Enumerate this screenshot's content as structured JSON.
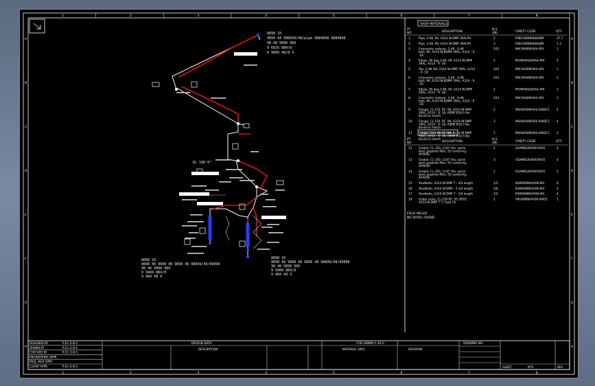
{
  "drawing": {
    "grid_top_numbers": [
      "1",
      "2",
      "3",
      "4",
      "5",
      "6",
      "7",
      "8"
    ],
    "grid_side_letters": [
      "A",
      "B",
      "C",
      "D",
      "E",
      "F",
      "G",
      "H"
    ]
  },
  "shop_parts": {
    "title": "SHOP MATERIALS",
    "col_pt": "PT\nNO",
    "col_desc": "DESCRIPTION",
    "col_nd": "N.S.\n(IN)",
    "col_code": "CMDTY CODE",
    "col_qty": "QTY",
    "rows": [
      {
        "pt": "1",
        "desc": "Pipe, 3-48 ,90, A314 W-DMP 39ALPH",
        "nd": "2",
        "code": "P4841W0N6N4848M",
        "qty": "37.7"
      },
      {
        "pt": "2",
        "desc": "Pipe, 3-48 ,90, A314 W-DMP 39ALPH",
        "nd": "3",
        "code": "P4841W0N6N4848M",
        "qty": "1.3"
      },
      {
        "pt": "3",
        "desc": "Concentric reducer, 2-48 , A-48 butt, 90, A314 W-BDMP 39AL, A314 - 9 -18",
        "nd": "2X3",
        "code": "M6C4H60WI4A4-4P4",
        "qty": "1"
      },
      {
        "pt": "4",
        "desc": "Elbow, 90 deg 3-48 ,90, A314 W-DMP 39AL, A314 - 9 -18",
        "nd": "2",
        "code": "MCM6406LW4A4-4P4",
        "qty": "4"
      },
      {
        "pt": "5",
        "desc": "Tee, 2-48 ,90, A314 W-DMP 39AL, A314 - 9 -18",
        "nd": "2X3",
        "code": "M6C4H60WI4A4-4P4",
        "qty": "1"
      },
      {
        "pt": "6",
        "desc": "Concentric reducer, 2-48 , A-48 butt, 90, A314 W-BDMP 39AL, A314 - 9 -18",
        "nd": "2X3",
        "code": "M6C4H60WI4A4-4P4",
        "qty": "2"
      },
      {
        "pt": "7",
        "desc": "Elbow, 90 deg 3-48 ,90, A314 W-DMP 39AL, A314 - 9 -18",
        "nd": "2",
        "code": "MCM6406LW4A4-4P4",
        "qty": "3"
      },
      {
        "pt": "8",
        "desc": "Concentric reducer, 2-48 , A-48 butt, 90, A314 W-BDMP 39AL, A314 - 9 -18",
        "nd": "2X3",
        "code": "M6C4H60WI4A4-4P4",
        "qty": "2"
      },
      {
        "pt": "9",
        "desc": "Flange, CL-150, RF, 90, A314 W-DMP 39AL, A314 - 9 -18, ASME B16.5 lbs bored to match",
        "nd": "2",
        "code": "M6A4H60WI4A4-406DC1",
        "qty": "4"
      },
      {
        "pt": "10",
        "desc": "Flange, CL-150, RF, 90, A314 W-DMP 39AL, A314 - 9 -18, ASME B16.5 lbs bored to match",
        "nd": "3",
        "code": "M6A4H60WI4A4-406DC1",
        "qty": "4"
      },
      {
        "pt": "11",
        "desc": "Flange, CL-150, RF, 90, A314 W-DMP 39AL, A314 - 9 -18, ASME B16.5 lbs bored to match",
        "nd": "2",
        "code": "M6A4H60WI4A4-406DC1",
        "qty": "2"
      }
    ]
  },
  "erection": {
    "title": "ERECTION MATERIALS",
    "col_pt": "PT\nNO",
    "col_desc": "DESCRIPTION",
    "col_nd": "N.S.\n(IN)",
    "col_code": "CMDTY CODE",
    "col_qty": "QTY",
    "rows": [
      {
        "pt": "12",
        "desc": "Gasket, CL-150, 1/16\" thk, spiral wnd, graphite filler, SS centering, AF9458",
        "nd": "2",
        "code": "GSAM6GAE9001P4U5",
        "qty": "4"
      },
      {
        "pt": "13",
        "desc": "Gasket, CL-150, 1/16\" thk, spiral wnd, graphite filler, SS centering, AF9458",
        "nd": "3",
        "code": "GSAM6GAE9001P4U5",
        "qty": "4"
      },
      {
        "pt": "14",
        "desc": "Gasket, CL-150, 1/16\" thk, spiral wnd, graphite filler, SS centering, AF9458",
        "nd": "2",
        "code": "GSAM6GAE9001P4U5",
        "qty": "2"
      },
      {
        "pt": "15",
        "desc": "Studbolts, A314 W-DMP 7 - 3/4 length",
        "nd": "1/2",
        "code": "B4W6W6NA4V89-W4",
        "qty": "8"
      },
      {
        "pt": "16",
        "desc": "Studbolts, A314 W-DMP - 3 3/4 length",
        "nd": "5/8",
        "code": "B4W6W6NA4V89-W4",
        "qty": "4"
      },
      {
        "pt": "17",
        "desc": "Studbolts, A314 W-DMP 7 - 3/4 length",
        "nd": "1/2",
        "code": "B4W6W6NA4V89-W4",
        "qty": "4"
      },
      {
        "pt": "18",
        "desc": "Globe valve, CL-150 RF, SS, BOLT, A314 W-DMP 7 7 / butt rfs",
        "nd": "2",
        "code": "V4G6W6NA4V89-W4SS",
        "qty": "1"
      }
    ]
  },
  "fab_notes": [
    "FIELD WELDS",
    "NO SPOOL FOUND"
  ],
  "annotations": {
    "top_right": [
      "8898 10",
      "9899 44 998699/48/pipe 9884898 9884898",
      "98 48 9898 989",
      "9 6816 884/8",
      "8 9899 48/8 4"
    ],
    "bottom_left": [
      "8898 10",
      "9898 48 9898 48 9898 48 98899/48/89898",
      "98 48 9898 989",
      "9 9484 884/8",
      "9 484 48 9"
    ],
    "bottom_right": [
      "8898 10",
      "9898 48 9898 48 9898 48 98899/48/89898",
      "98 48 9898 989",
      "9 9484 884/8",
      "9 484 48 9"
    ],
    "elevation_tag": "EL 100'0\""
  },
  "title_block": {
    "left_rows": [
      {
        "k": "DESIGNED BY",
        "v": "R.D.I.G.N.S"
      },
      {
        "k": "DRAWN BY",
        "v": "R.D.I.G.N.S"
      },
      {
        "k": "CHECKED BY",
        "v": "R.D.I.G.N.S"
      },
      {
        "k": "ENGINEERING APPR.",
        "v": ""
      },
      {
        "k": "PROJ. MGR APPR.",
        "v": ""
      },
      {
        "k": "CLIENT APPR.",
        "v": "R.D.I.G.N.S"
      }
    ],
    "design_data": "DESIGN DATA",
    "description_hdr": "DESCRIPTION",
    "material_hdr": "MATERIAL SPEC.",
    "revision_hdr": "REVISION",
    "drawing_no": "DRAWING NO.",
    "sheet": "SHEET",
    "rev": "REV",
    "company": "CYB-OBWM-1-40-0",
    "scale": "NTS"
  }
}
